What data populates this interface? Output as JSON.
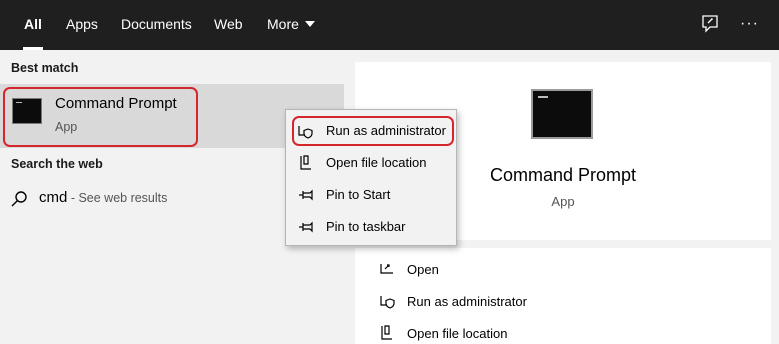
{
  "tabs": [
    {
      "label": "All",
      "active": true
    },
    {
      "label": "Apps",
      "active": false
    },
    {
      "label": "Documents",
      "active": false
    },
    {
      "label": "Web",
      "active": false
    },
    {
      "label": "More",
      "active": false
    }
  ],
  "top_icons": {
    "feedback": "feedback-icon",
    "more": "ellipsis-icon",
    "ellipsis_text": "···"
  },
  "left": {
    "best_match_title": "Best match",
    "best_match": {
      "title": "Command Prompt",
      "subtitle": "App",
      "icon": "command-prompt-icon"
    },
    "search_web_title": "Search the web",
    "web_result": {
      "query": "cmd",
      "suffix": " - See web results",
      "icon": "search-icon"
    }
  },
  "context_menu": [
    {
      "label": "Run as administrator",
      "icon": "shield-icon"
    },
    {
      "label": "Open file location",
      "icon": "folder-location-icon"
    },
    {
      "label": "Pin to Start",
      "icon": "pin-icon"
    },
    {
      "label": "Pin to taskbar",
      "icon": "pin-icon"
    }
  ],
  "preview": {
    "title": "Command Prompt",
    "subtitle": "App",
    "actions": [
      {
        "label": "Open",
        "icon": "open-icon"
      },
      {
        "label": "Run as administrator",
        "icon": "shield-icon"
      },
      {
        "label": "Open file location",
        "icon": "folder-location-icon"
      }
    ]
  },
  "colors": {
    "topbar": "#1f1f1f",
    "highlight": "#d6262d",
    "selected_row": "#d9d9d9",
    "panel": "#f2f2f2"
  }
}
